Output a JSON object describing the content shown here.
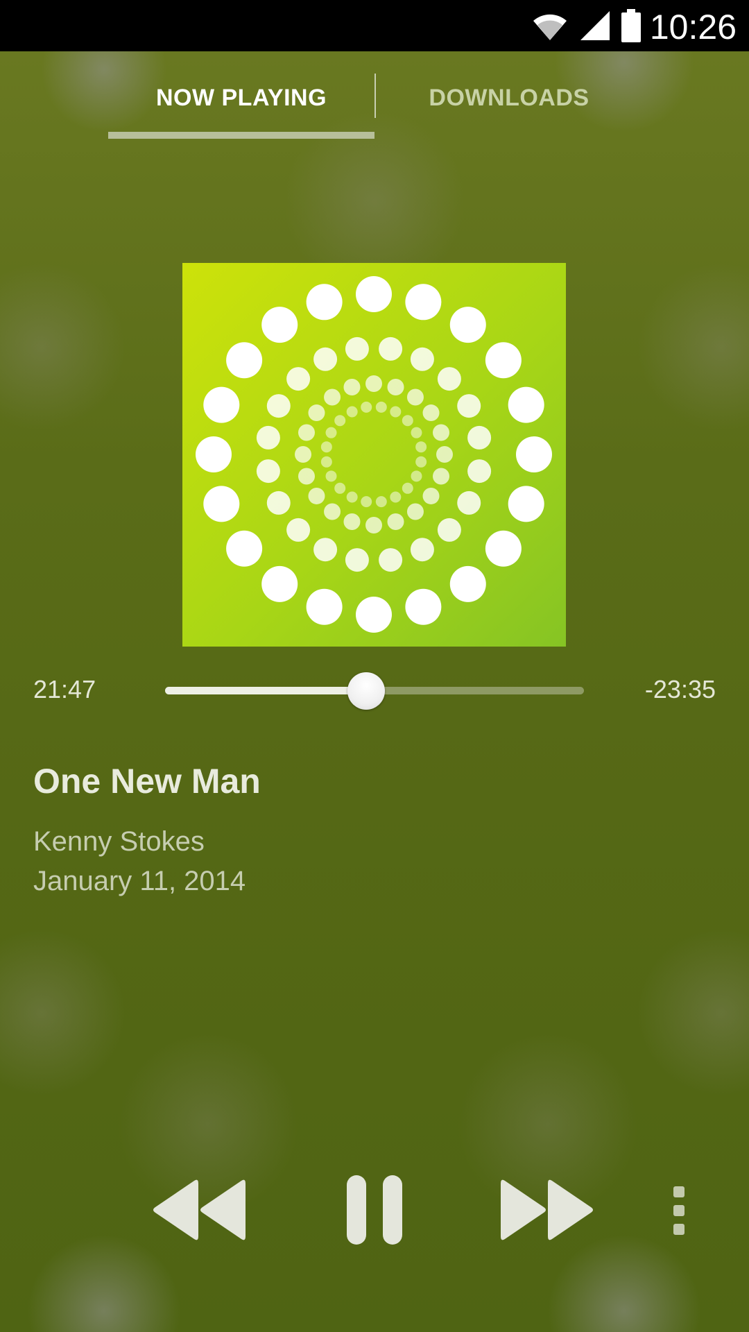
{
  "status_bar": {
    "time": "10:26",
    "icons": [
      "wifi-icon",
      "cell-signal-icon",
      "battery-icon"
    ]
  },
  "tabs": [
    {
      "label": "NOW PLAYING",
      "active": true
    },
    {
      "label": "DOWNLOADS",
      "active": false
    }
  ],
  "player": {
    "elapsed": "21:47",
    "remaining": "-23:35",
    "progress": 0.48,
    "title": "One New Man",
    "artist": "Kenny Stokes",
    "date": "January 11, 2014"
  },
  "controls": {
    "icons": [
      "rewind-icon",
      "pause-icon",
      "fast-forward-icon",
      "more-vert-icon"
    ]
  },
  "colors": {
    "background": "#566b18",
    "album_art_top": "#cde20a",
    "album_art_bottom": "#86c424"
  }
}
